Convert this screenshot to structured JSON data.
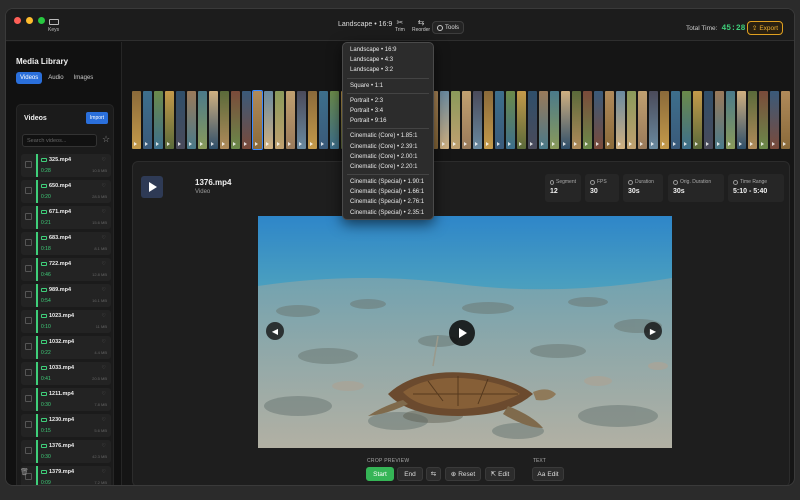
{
  "toolbar": {
    "keys_label": "Keys",
    "aspect_label": "Landscape • 16:9",
    "trim_label": "Trim",
    "reorder_label": "Reorder",
    "tools_label": "Tools",
    "total_label": "Total Time:",
    "total_value": "45:28",
    "export_label": "Export"
  },
  "aspect_menu": {
    "groups": [
      [
        "Landscape • 16:9",
        "Landscape • 4:3",
        "Landscape • 3:2"
      ],
      [
        "Square • 1:1"
      ],
      [
        "Portrait • 2:3",
        "Portrait • 3:4",
        "Portrait • 9:16"
      ],
      [
        "Cinematic (Core) • 1.85:1",
        "Cinematic (Core) • 2.39:1",
        "Cinematic (Core) • 2.00:1",
        "Cinematic (Core) • 2.20:1"
      ],
      [
        "Cinematic (Special) • 1.90:1",
        "Cinematic (Special) • 1.66:1",
        "Cinematic (Special) • 2.76:1",
        "Cinematic (Special) • 2.35:1"
      ]
    ]
  },
  "sidebar": {
    "title": "Media Library",
    "tabs": [
      "Videos",
      "Audio",
      "Images"
    ],
    "active_tab": 0,
    "panel_title": "Videos",
    "import_label": "Import",
    "search_placeholder": "Search videos...",
    "videos": [
      {
        "name": "325.mp4",
        "duration": "0:28",
        "size": "10.5 MB"
      },
      {
        "name": "650.mp4",
        "duration": "0:20",
        "size": "28.5 MB"
      },
      {
        "name": "671.mp4",
        "duration": "0:21",
        "size": "15.6 MB"
      },
      {
        "name": "683.mp4",
        "duration": "0:18",
        "size": "8.1 MB"
      },
      {
        "name": "722.mp4",
        "duration": "0:46",
        "size": "12.8 MB"
      },
      {
        "name": "989.mp4",
        "duration": "0:54",
        "size": "16.1 MB"
      },
      {
        "name": "1023.mp4",
        "duration": "0:10",
        "size": "11 MB"
      },
      {
        "name": "1032.mp4",
        "duration": "0:22",
        "size": "4.4 MB"
      },
      {
        "name": "1033.mp4",
        "duration": "0:41",
        "size": "20.5 MB"
      },
      {
        "name": "1211.mp4",
        "duration": "0:30",
        "size": "7.8 MB"
      },
      {
        "name": "1230.mp4",
        "duration": "0:15",
        "size": "5.6 MB"
      },
      {
        "name": "1376.mp4",
        "duration": "0:30",
        "size": "42.3 MB"
      },
      {
        "name": "1379.mp4",
        "duration": "0:09",
        "size": "7.2 MB"
      }
    ]
  },
  "clip": {
    "name": "1376.mp4",
    "type": "Video",
    "stats": [
      {
        "label": "Segment",
        "value": "12"
      },
      {
        "label": "FPS",
        "value": "30"
      },
      {
        "label": "Duration",
        "value": "30s"
      },
      {
        "label": "Orig. Duration",
        "value": "30s"
      },
      {
        "label": "Time Range",
        "value": "5:10 - 5:40"
      }
    ]
  },
  "controls": {
    "crop_label": "CROP PREVIEW",
    "text_label": "TEXT",
    "start": "Start",
    "end": "End",
    "reset": "Reset",
    "edit": "Edit",
    "text_edit": "Edit"
  },
  "colors": {
    "accent_blue": "#2a6fdb",
    "accent_green": "#3fcf7a",
    "start_green": "#35b556",
    "export_orange": "#f0b030"
  }
}
